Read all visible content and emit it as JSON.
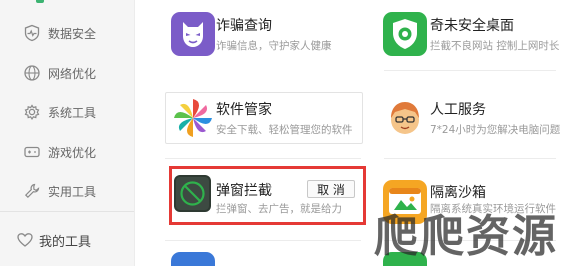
{
  "sidebar": {
    "items": [
      {
        "label": "数据安全",
        "icon": "heartbeat-shield-icon"
      },
      {
        "label": "网络优化",
        "icon": "globe-icon"
      },
      {
        "label": "系统工具",
        "icon": "gear-icon"
      },
      {
        "label": "游戏优化",
        "icon": "gamepad-icon"
      },
      {
        "label": "实用工具",
        "icon": "wrench-icon"
      }
    ],
    "my_tools": {
      "label": "我的工具",
      "icon": "heart-icon"
    }
  },
  "cards": {
    "fraud": {
      "title": "诈骗查询",
      "desc": "诈骗信息，守护家人健康",
      "icon": "mask-icon"
    },
    "qiwei": {
      "title": "奇未安全桌面",
      "desc": "拦截不良网站 控制上网时长",
      "icon": "green-shield-icon"
    },
    "software": {
      "title": "软件管家",
      "desc": "安全下载、轻松管理您的软件",
      "icon": "colorful-flower-icon"
    },
    "service": {
      "title": "人工服务",
      "desc": "7*24小时为您解决电脑问题",
      "icon": "service-person-icon"
    },
    "popup": {
      "title": "弹窗拦截",
      "desc": "拦弹窗、去广告，就是给力",
      "icon": "popup-block-icon",
      "button": "取 消"
    },
    "sandbox": {
      "title": "隔离沙箱",
      "desc": "隔离系统真实环境运行软件",
      "icon": "sandbox-icon"
    }
  },
  "watermark": "爬爬资源",
  "colors": {
    "accent": "#3cb371",
    "highlight_border": "#e53935"
  }
}
